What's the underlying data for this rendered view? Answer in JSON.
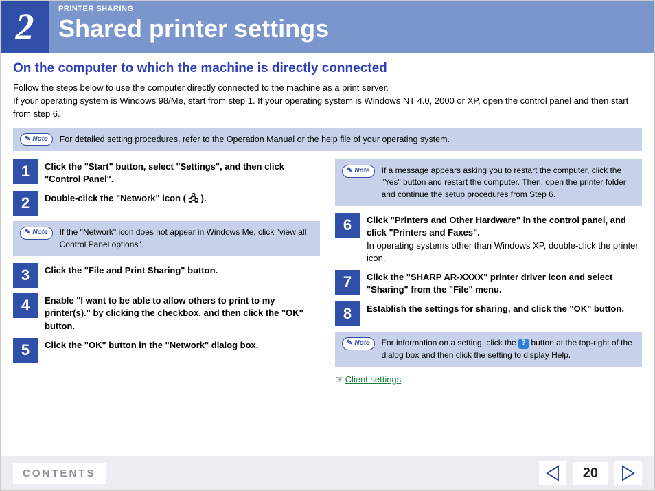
{
  "header": {
    "chapter_number": "2",
    "eyebrow": "PRINTER SHARING",
    "title": "Shared printer settings"
  },
  "subhead": "On the computer to which the machine is directly connected",
  "intro": "Follow the steps below to use the computer directly connected to the machine as a print server.\nIf your operating system is Windows 98/Me, start from step 1. If your operating system is Windows NT 4.0, 2000 or XP, open the control panel and then start from step 6.",
  "top_note": {
    "label": "Note",
    "text": "For detailed setting procedures, refer to the Operation Manual or the help file of your operating system."
  },
  "left_steps": [
    {
      "n": "1",
      "text": "Click the \"Start\" button, select \"Settings\", and then click \"Control Panel\"."
    },
    {
      "n": "2",
      "text": "Double-click the \"Network\" icon ( 🖧 )."
    }
  ],
  "left_note": {
    "label": "Note",
    "text": "If the \"Network\" icon does not appear in Windows Me, click \"view all Control Panel options\"."
  },
  "left_steps_2": [
    {
      "n": "3",
      "text": "Click the \"File and Print Sharing\" button."
    },
    {
      "n": "4",
      "text": "Enable \"I want to be able to allow others to print to my printer(s).\" by clicking the checkbox, and then click the \"OK\" button."
    },
    {
      "n": "5",
      "text": "Click the \"OK\" button in the \"Network\" dialog box."
    }
  ],
  "right_note_top": {
    "label": "Note",
    "text": "If a message appears asking you to restart the computer, click the \"Yes\" button and restart the computer. Then, open the printer folder and continue the setup procedures from Step 6."
  },
  "right_steps": [
    {
      "n": "6",
      "text": "Click \"Printers and Other Hardware\" in the control panel, and click \"Printers and Faxes\".",
      "sub": "In operating systems other than Windows XP, double-click the printer icon."
    },
    {
      "n": "7",
      "text": "Click the \"SHARP AR-XXXX\" printer driver icon and select \"Sharing\" from the \"File\" menu."
    },
    {
      "n": "8",
      "text": "Establish the settings for sharing, and click the \"OK\" button."
    }
  ],
  "right_note_bottom": {
    "label": "Note",
    "text_before": "For information on a setting, click the ",
    "text_after": " button at the top-right of the dialog box and then click the setting to display Help."
  },
  "link": {
    "text": "Client settings"
  },
  "footer": {
    "contents": "CONTENTS",
    "page": "20"
  }
}
